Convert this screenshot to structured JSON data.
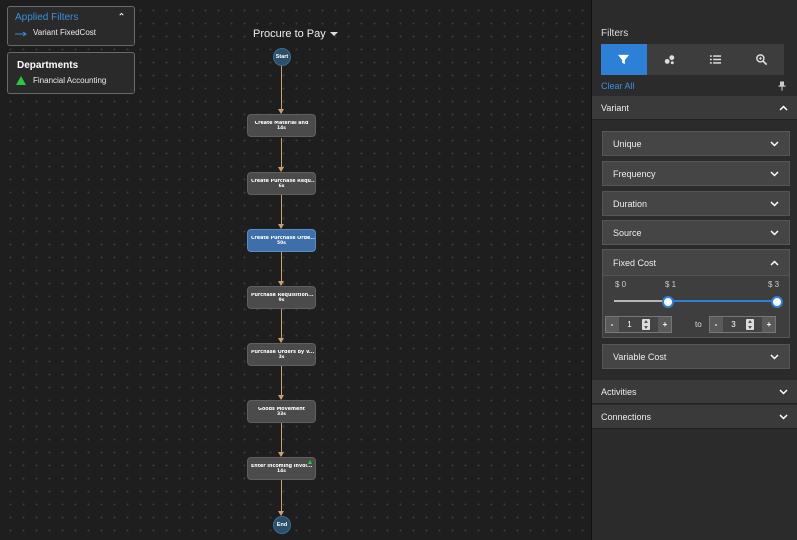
{
  "applied_filters": {
    "title": "Applied Filters",
    "items": [
      {
        "label": "Variant FixedCost"
      }
    ]
  },
  "departments": {
    "title": "Departments",
    "items": [
      {
        "label": "Financial Accounting",
        "color": "#27c93f"
      }
    ]
  },
  "process": {
    "title": "Procure to Pay",
    "start_label": "Start",
    "end_label": "End",
    "nodes": [
      {
        "name": "Create Material and",
        "duration": "14s"
      },
      {
        "name": "Create Purchase Requ...",
        "duration": "6s"
      },
      {
        "name": "Create Purchase Orde...",
        "duration": "50s",
        "active": true
      },
      {
        "name": "Purchase Requisition...",
        "duration": "9s"
      },
      {
        "name": "Purchase Orders by V...",
        "duration": "3s"
      },
      {
        "name": "Goods Movement",
        "duration": "33s"
      },
      {
        "name": "Enter Incoming Invoi...",
        "duration": "14s"
      }
    ]
  },
  "filters_panel": {
    "title": "Filters",
    "tabs": [
      {
        "icon": "filter-icon",
        "active": true
      },
      {
        "icon": "bubbles-icon"
      },
      {
        "icon": "list-icon"
      },
      {
        "icon": "search-icon"
      }
    ],
    "clear_all": "Clear All",
    "variant_section": "Variant",
    "subsections": [
      "Unique",
      "Frequency",
      "Duration",
      "Source"
    ],
    "fixed_cost": {
      "title": "Fixed Cost",
      "tick_min": "$ 0",
      "tick_mid": "$ 1",
      "tick_max": "$ 3",
      "min_value": "1",
      "max_value": "3",
      "to_label": "to",
      "range": [
        1,
        3
      ],
      "scale_max": 3
    },
    "variable_cost": "Variable Cost",
    "activities": "Activities",
    "connections": "Connections",
    "accent_color": "#2e80d6"
  }
}
